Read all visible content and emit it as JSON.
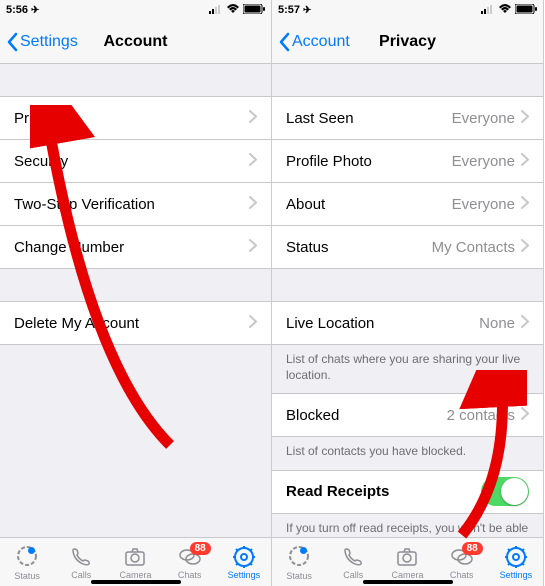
{
  "left": {
    "status": {
      "time": "5:56",
      "loc_icon": "↑"
    },
    "nav": {
      "back": "Settings",
      "title": "Account"
    },
    "rows": [
      {
        "label": "Privacy"
      },
      {
        "label": "Security"
      },
      {
        "label": "Two-Step Verification"
      },
      {
        "label": "Change Number"
      }
    ],
    "delete": {
      "label": "Delete My Account"
    }
  },
  "right": {
    "status": {
      "time": "5:57",
      "loc_icon": "↑"
    },
    "nav": {
      "back": "Account",
      "title": "Privacy"
    },
    "group1": [
      {
        "label": "Last Seen",
        "value": "Everyone"
      },
      {
        "label": "Profile Photo",
        "value": "Everyone"
      },
      {
        "label": "About",
        "value": "Everyone"
      },
      {
        "label": "Status",
        "value": "My Contacts"
      }
    ],
    "live": {
      "label": "Live Location",
      "value": "None",
      "note": "List of chats where you are sharing your live location."
    },
    "blocked": {
      "label": "Blocked",
      "value": "2 contacts",
      "note": "List of contacts you have blocked."
    },
    "receipts": {
      "label": "Read Receipts",
      "note": "If you turn off read receipts, you won't be able to see read receipts from other people. Read receipts are always sent for group chats."
    }
  },
  "tabs": {
    "status": "Status",
    "calls": "Calls",
    "camera": "Camera",
    "chats": "Chats",
    "settings": "Settings",
    "chats_badge": "88"
  },
  "colors": {
    "accent": "#007aff",
    "red": "#ff3b30",
    "green": "#4cd964"
  }
}
